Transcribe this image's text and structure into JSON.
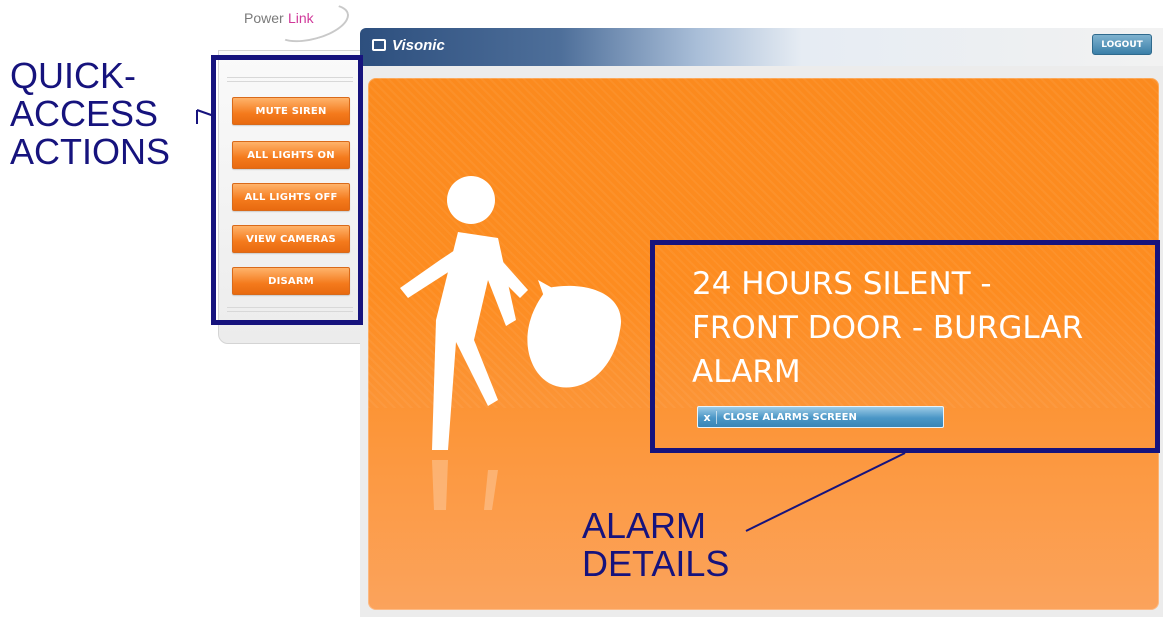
{
  "logo": {
    "part1": "Power",
    "part2": "Link"
  },
  "header": {
    "brand": "Visonic",
    "logout_label": "LOGOUT"
  },
  "quick_actions": {
    "buttons": [
      {
        "label": "MUTE SIREN"
      },
      {
        "label": "ALL LIGHTS ON"
      },
      {
        "label": "ALL LIGHTS OFF"
      },
      {
        "label": "VIEW CAMERAS"
      },
      {
        "label": "DISARM"
      }
    ]
  },
  "alarm": {
    "message_line1": "24 HOURS SILENT -",
    "message_line2": "FRONT DOOR - BURGLAR",
    "message_line3": "ALARM",
    "close_icon": "x",
    "close_label": "CLOSE ALARMS SCREEN"
  },
  "annotations": {
    "quick_access_line1": "QUICK-",
    "quick_access_line2": "ACCESS",
    "quick_access_line3": "ACTIONS",
    "alarm_details_line1": "ALARM",
    "alarm_details_line2": "DETAILS"
  },
  "colors": {
    "accent_orange": "#fb8a1e",
    "annotation_navy": "#16137d",
    "header_blue": "#2d4f7e"
  }
}
